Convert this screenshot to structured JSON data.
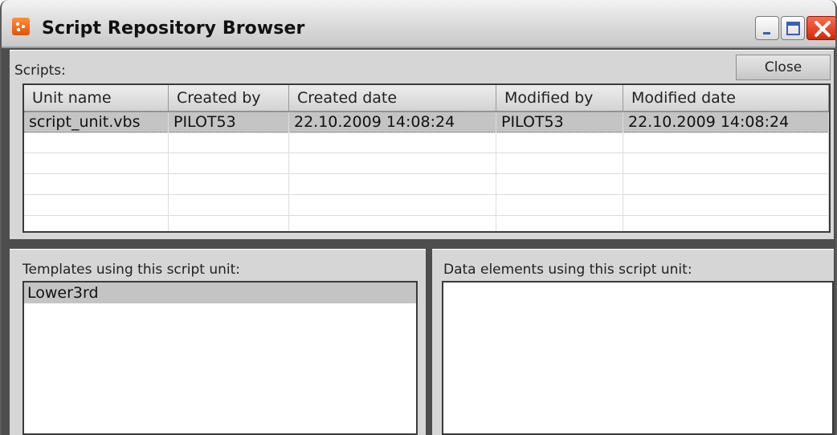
{
  "window": {
    "title": "Script Repository Browser"
  },
  "scripts_panel": {
    "label": "Scripts:",
    "close_label": "Close",
    "columns": [
      "Unit name",
      "Created by",
      "Created date",
      "Modified by",
      "Modified date"
    ],
    "rows": [
      [
        "script_unit.vbs",
        "PILOT53",
        "22.10.2009 14:08:24",
        "PILOT53",
        "22.10.2009 14:08:24"
      ]
    ]
  },
  "templates_panel": {
    "label": "Templates using this script unit:",
    "items": [
      "Lower3rd"
    ]
  },
  "data_elements_panel": {
    "label": "Data elements using this script unit:",
    "items": []
  },
  "colors": {
    "window_frame": "#4d4d4d",
    "panel_bg": "#d6d6d6",
    "selection_bg": "#c4c4c4",
    "app_icon": "#e2520a",
    "close_button": "#d2280a"
  },
  "icons": {
    "app": "app-icon",
    "minimize": "minimize-icon",
    "maximize": "maximize-icon",
    "close": "close-icon"
  }
}
